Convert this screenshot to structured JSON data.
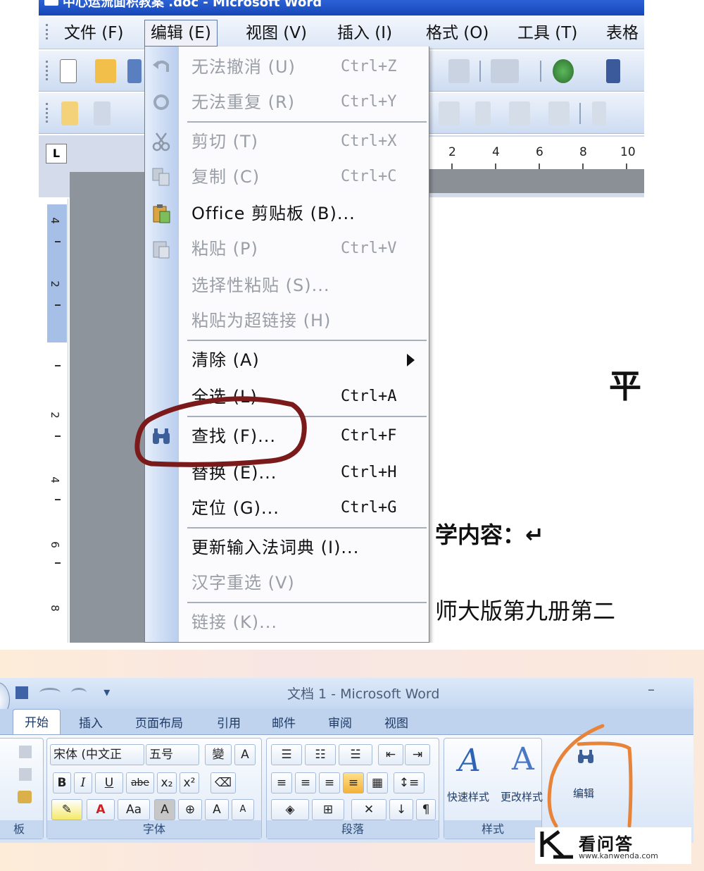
{
  "word2003": {
    "title": "中心运流面积教案 .doc - Microsoft Word",
    "menu": [
      "文件 (F)",
      "编辑 (E)",
      "视图 (V)",
      "插入 (I)",
      "格式 (O)",
      "工具 (T)",
      "表格"
    ],
    "ruler_corner": "L",
    "ruler_ticks": [
      "2",
      "4",
      "6",
      "8",
      "10"
    ],
    "vruler_numbers": [
      "4",
      "2",
      "2",
      "4",
      "6",
      "8"
    ],
    "edit_menu": [
      {
        "label": "无法撤消 (U)",
        "shortcut": "Ctrl+Z",
        "enabled": false,
        "icon": "undo-icon"
      },
      {
        "label": "无法重复 (R)",
        "shortcut": "Ctrl+Y",
        "enabled": false,
        "icon": "redo-icon"
      },
      {
        "label": "剪切 (T)",
        "shortcut": "Ctrl+X",
        "enabled": false,
        "icon": "scissors-icon"
      },
      {
        "label": "复制 (C)",
        "shortcut": "Ctrl+C",
        "enabled": false,
        "icon": "copy-icon"
      },
      {
        "label": "Office 剪贴板 (B)...",
        "shortcut": "",
        "enabled": true,
        "icon": "clipboard-icon"
      },
      {
        "label": "粘贴 (P)",
        "shortcut": "Ctrl+V",
        "enabled": false,
        "icon": "paste-icon"
      },
      {
        "label": "选择性粘贴 (S)...",
        "shortcut": "",
        "enabled": false,
        "icon": ""
      },
      {
        "label": "粘贴为超链接 (H)",
        "shortcut": "",
        "enabled": false,
        "icon": ""
      },
      {
        "label": "清除 (A)",
        "shortcut": "",
        "enabled": true,
        "icon": "",
        "submenu": true
      },
      {
        "label": "全选 (L)",
        "shortcut": "Ctrl+A",
        "enabled": true,
        "icon": ""
      },
      {
        "label": "查找 (F)...",
        "shortcut": "Ctrl+F",
        "enabled": true,
        "icon": "binoculars-icon"
      },
      {
        "label": "替换 (E)...",
        "shortcut": "Ctrl+H",
        "enabled": true,
        "icon": ""
      },
      {
        "label": "定位 (G)...",
        "shortcut": "Ctrl+G",
        "enabled": true,
        "icon": ""
      },
      {
        "label": "更新输入法词典 (I)...",
        "shortcut": "",
        "enabled": true,
        "icon": ""
      },
      {
        "label": "汉字重选 (V)",
        "shortcut": "",
        "enabled": false,
        "icon": ""
      },
      {
        "label": "链接 (K)...",
        "shortcut": "",
        "enabled": false,
        "icon": ""
      }
    ],
    "doc_text": {
      "big_char": "平",
      "heading": "学内容：↵",
      "line": "师大版第九册第二"
    }
  },
  "word2007": {
    "title": "文档 1 - Microsoft Word",
    "qat": "▾",
    "tabs": [
      "开始",
      "插入",
      "页面布局",
      "引用",
      "邮件",
      "审阅",
      "视图"
    ],
    "font_name": "宋体 (中文正",
    "font_size": "五号",
    "groups": {
      "clipboard": "板",
      "font": "字体",
      "paragraph": "段落",
      "styles": "样式"
    },
    "style_buttons": [
      "快速样式",
      "更改样式"
    ],
    "edit_button": "编辑",
    "format_buttons": [
      "B",
      "I",
      "U",
      "abe",
      "x₂",
      "x²"
    ],
    "watermark": {
      "text": "看问答",
      "url": "www.kanwenda.com"
    }
  },
  "colors": {
    "annotation_top": "#7a1a1a",
    "annotation_bottom": "#e8843a",
    "menu_icon_column": "#b9cdee"
  }
}
